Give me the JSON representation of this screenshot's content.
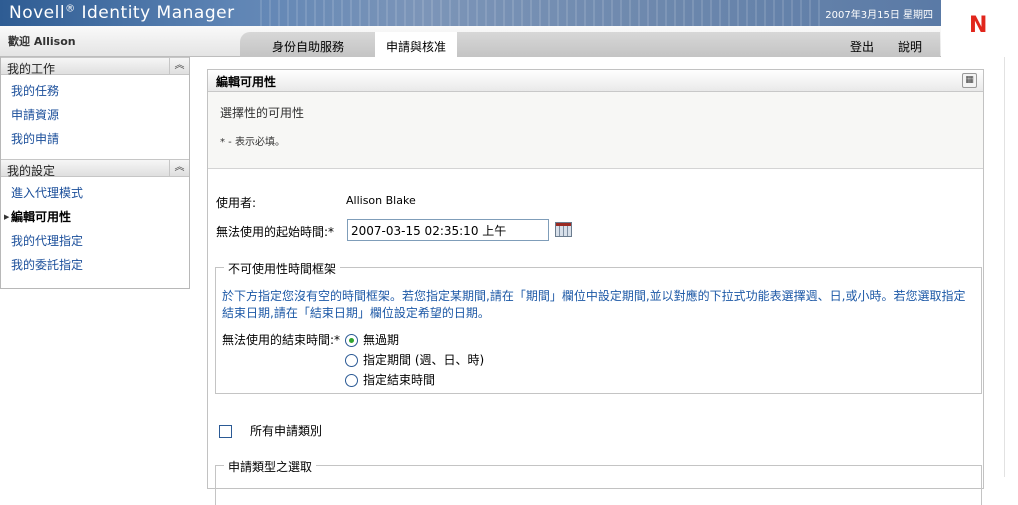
{
  "header": {
    "brand": "Novell",
    "brand_mark": "®",
    "product": "Identity Manager",
    "date": "2007年3月15日 星期四",
    "welcome": "歡迎 Allison",
    "tabs": [
      {
        "label": "身份自助服務",
        "selected": false
      },
      {
        "label": "申請與核准",
        "selected": true
      }
    ],
    "logout_label": "登出",
    "help_label": "說明",
    "logo_letter": "N",
    "logo_color": "#e1261c"
  },
  "sidebar": {
    "sections": [
      {
        "title": "我的工作",
        "collapse_icon": "chevron-up-icon",
        "items": [
          {
            "label": "我的任務"
          },
          {
            "label": "申請資源"
          },
          {
            "label": "我的申請"
          }
        ]
      },
      {
        "title": "我的設定",
        "collapse_icon": "chevron-up-icon",
        "items": [
          {
            "label": "進入代理模式"
          },
          {
            "label": "編輯可用性",
            "active": true
          },
          {
            "label": "我的代理指定"
          },
          {
            "label": "我的委託指定"
          }
        ]
      }
    ]
  },
  "panel": {
    "title": "編輯可用性",
    "layout_icon": "layout-grid-icon",
    "description": "選擇性的可用性",
    "required_note": "* - 表示必填。",
    "user_label": "使用者:",
    "user_value": "Allison Blake",
    "start_label": "無法使用的起始時間:*",
    "start_value": "2007-03-15 02:35:10 上午",
    "calendar_icon": "calendar-icon",
    "timeframe": {
      "legend": "不可使用性時間框架",
      "description": "於下方指定您沒有空的時間框架。若您指定某期間,請在「期間」欄位中設定期間,並以對應的下拉式功能表選擇週、日,或小時。若您選取指定結束日期,請在「結束日期」欄位設定希望的日期。",
      "end_label": "無法使用的結束時間:*",
      "options": [
        {
          "label": "無過期",
          "selected": true
        },
        {
          "label": "指定期間 (週、日、時)",
          "selected": false
        },
        {
          "label": "指定結束時間",
          "selected": false
        }
      ]
    },
    "all_categories_label": "所有申請類別",
    "all_categories_checked": false,
    "category_legend": "申請類型之選取"
  },
  "colors": {
    "link": "#1a4e9a",
    "info_text": "#1c58a6",
    "radio_selected": "#2fa32f",
    "banner": "#5f85b5"
  }
}
